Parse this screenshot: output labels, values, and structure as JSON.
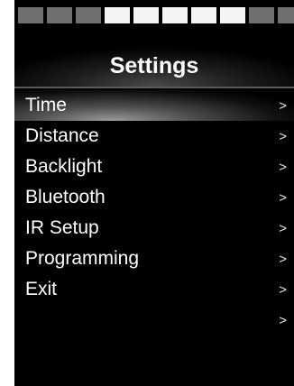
{
  "header": {
    "title": "Settings",
    "battery_level": 0.5
  },
  "menu": {
    "items": [
      {
        "label": "Time",
        "arrow": ">",
        "selected": true
      },
      {
        "label": "Distance",
        "arrow": ">"
      },
      {
        "label": "Backlight",
        "arrow": ">"
      },
      {
        "label": "Bluetooth",
        "arrow": ">"
      },
      {
        "label": "IR Setup",
        "arrow": ">"
      },
      {
        "label": "Programming",
        "arrow": ">"
      },
      {
        "label": "Exit",
        "arrow": ">"
      },
      {
        "label": "",
        "arrow": ">"
      }
    ]
  },
  "colors": {
    "background": "#000000",
    "text": "#ffffff",
    "segment_lit": "#f4f4f4",
    "segment_dim": "#6e6e6e"
  }
}
